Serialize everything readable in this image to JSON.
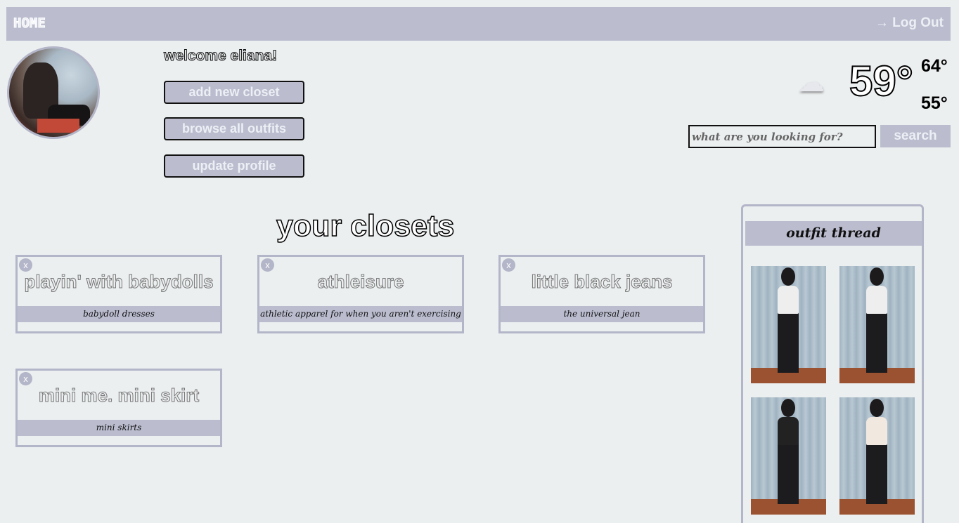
{
  "nav": {
    "home": "HOME",
    "logout": "→ Log Out"
  },
  "welcome": "welcome eliana!",
  "actions": {
    "add_closet": "add new closet",
    "browse": "browse all outfits",
    "update": "update profile"
  },
  "weather": {
    "icon": "cloud-icon",
    "glyph": "☁",
    "current": "59°",
    "high": "64°",
    "low": "55°"
  },
  "search": {
    "placeholder": "what are you looking for?",
    "button": "search"
  },
  "closets_title": "your closets",
  "closets": [
    {
      "name": "playin' with babydolls",
      "description": "babydoll dresses",
      "remove": "x"
    },
    {
      "name": "athleisure",
      "description": "athletic apparel for when you aren't exercising",
      "remove": "x"
    },
    {
      "name": "little black jeans",
      "description": "the universal jean",
      "remove": "x"
    },
    {
      "name": "mini me. mini skirt",
      "description": "mini skirts",
      "remove": "x"
    }
  ],
  "thread": {
    "title": "outfit thread"
  },
  "colors": {
    "accent": "#bbbdcf",
    "background": "#eceff0",
    "border": "#b3b5c8"
  }
}
